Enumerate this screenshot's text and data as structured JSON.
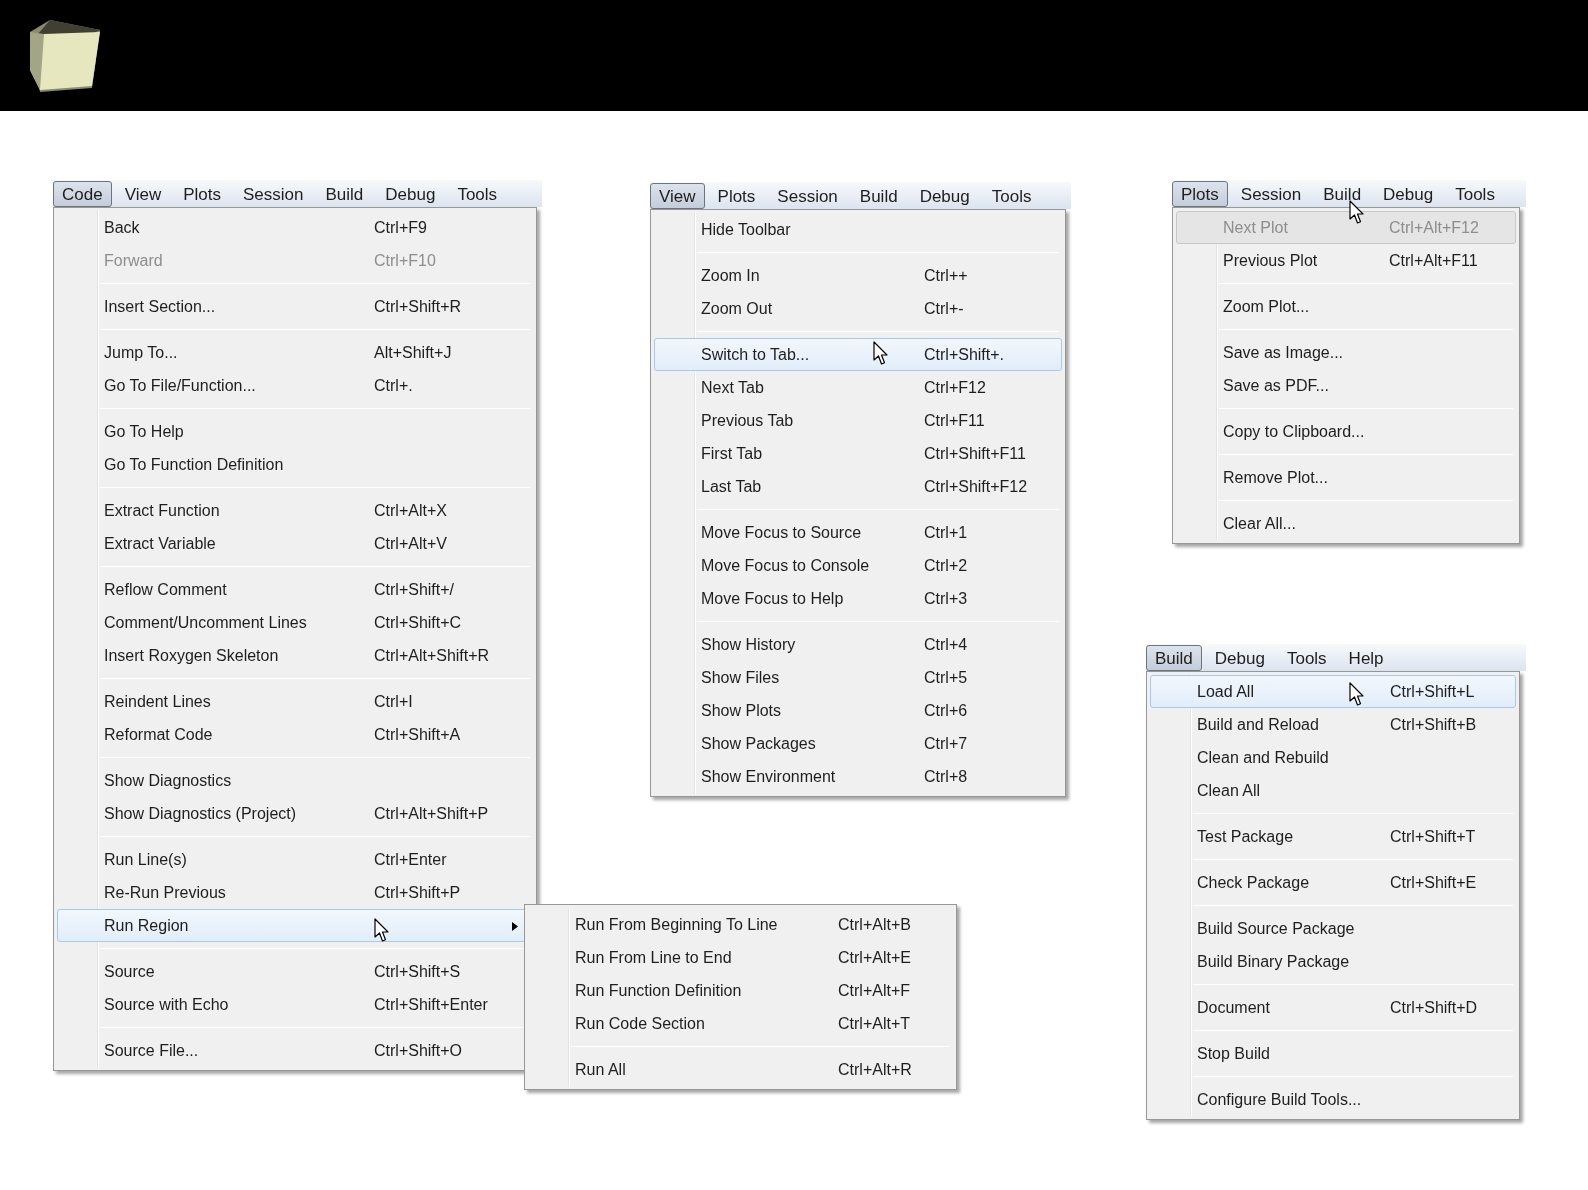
{
  "menus": [
    {
      "menubar": [
        {
          "label": "Code",
          "selected": true
        },
        {
          "label": "View",
          "selected": false
        },
        {
          "label": "Plots",
          "selected": false
        },
        {
          "label": "Session",
          "selected": false
        },
        {
          "label": "Build",
          "selected": false
        },
        {
          "label": "Debug",
          "selected": false
        },
        {
          "label": "Tools",
          "selected": false
        }
      ],
      "groups": [
        [
          {
            "label": "Back",
            "shortcut": "Ctrl+F9",
            "disabled": false,
            "selected": false
          },
          {
            "label": "Forward",
            "shortcut": "Ctrl+F10",
            "disabled": true,
            "selected": false
          }
        ],
        [
          {
            "label": "Insert Section...",
            "shortcut": "Ctrl+Shift+R",
            "disabled": false,
            "selected": false
          }
        ],
        [
          {
            "label": "Jump To...",
            "shortcut": "Alt+Shift+J",
            "disabled": false,
            "selected": false
          },
          {
            "label": "Go To File/Function...",
            "shortcut": "Ctrl+.",
            "disabled": false,
            "selected": false
          }
        ],
        [
          {
            "label": "Go To Help",
            "disabled": false,
            "selected": false
          },
          {
            "label": "Go To Function Definition",
            "disabled": false,
            "selected": false
          }
        ],
        [
          {
            "label": "Extract Function",
            "shortcut": "Ctrl+Alt+X",
            "disabled": false,
            "selected": false
          },
          {
            "label": "Extract Variable",
            "shortcut": "Ctrl+Alt+V",
            "disabled": false,
            "selected": false
          }
        ],
        [
          {
            "label": "Reflow Comment",
            "shortcut": "Ctrl+Shift+/",
            "disabled": false,
            "selected": false
          },
          {
            "label": "Comment/Uncomment Lines",
            "shortcut": "Ctrl+Shift+C",
            "disabled": false,
            "selected": false
          },
          {
            "label": "Insert Roxygen Skeleton",
            "shortcut": "Ctrl+Alt+Shift+R",
            "disabled": false,
            "selected": false
          }
        ],
        [
          {
            "label": "Reindent Lines",
            "shortcut": "Ctrl+I",
            "disabled": false,
            "selected": false
          },
          {
            "label": "Reformat Code",
            "shortcut": "Ctrl+Shift+A",
            "disabled": false,
            "selected": false
          }
        ],
        [
          {
            "label": "Show Diagnostics",
            "disabled": false,
            "selected": false
          },
          {
            "label": "Show Diagnostics (Project)",
            "shortcut": "Ctrl+Alt+Shift+P",
            "disabled": false,
            "selected": false
          }
        ],
        [
          {
            "label": "Run Line(s)",
            "shortcut": "Ctrl+Enter",
            "disabled": false,
            "selected": false
          },
          {
            "label": "Re-Run Previous",
            "shortcut": "Ctrl+Shift+P",
            "disabled": false,
            "selected": false
          },
          {
            "label": "Run Region",
            "disabled": false,
            "selected": true,
            "submenu": [
              [
                {
                  "label": "Run From Beginning To Line",
                  "shortcut": "Ctrl+Alt+B",
                  "disabled": false,
                  "selected": false
                },
                {
                  "label": "Run From Line to End",
                  "shortcut": "Ctrl+Alt+E",
                  "disabled": false,
                  "selected": false
                },
                {
                  "label": "Run Function Definition",
                  "shortcut": "Ctrl+Alt+F",
                  "disabled": false,
                  "selected": false
                },
                {
                  "label": "Run Code Section",
                  "shortcut": "Ctrl+Alt+T",
                  "disabled": false,
                  "selected": false
                }
              ],
              [
                {
                  "label": "Run All",
                  "shortcut": "Ctrl+Alt+R",
                  "disabled": false,
                  "selected": false
                }
              ]
            ]
          }
        ],
        [
          {
            "label": "Source",
            "shortcut": "Ctrl+Shift+S",
            "disabled": false,
            "selected": false
          },
          {
            "label": "Source with Echo",
            "shortcut": "Ctrl+Shift+Enter",
            "disabled": false,
            "selected": false
          }
        ],
        [
          {
            "label": "Source File...",
            "shortcut": "Ctrl+Shift+O",
            "disabled": false,
            "selected": false
          }
        ]
      ]
    },
    {
      "menubar": [
        {
          "label": "View",
          "selected": true
        },
        {
          "label": "Plots",
          "selected": false
        },
        {
          "label": "Session",
          "selected": false
        },
        {
          "label": "Build",
          "selected": false
        },
        {
          "label": "Debug",
          "selected": false
        },
        {
          "label": "Tools",
          "selected": false
        }
      ],
      "groups": [
        [
          {
            "label": "Hide Toolbar",
            "disabled": false,
            "selected": false
          }
        ],
        [
          {
            "label": "Zoom In",
            "shortcut": "Ctrl++",
            "disabled": false,
            "selected": false
          },
          {
            "label": "Zoom Out",
            "shortcut": "Ctrl+-",
            "disabled": false,
            "selected": false
          }
        ],
        [
          {
            "label": "Switch to Tab...",
            "shortcut": "Ctrl+Shift+.",
            "disabled": false,
            "selected": true
          },
          {
            "label": "Next Tab",
            "shortcut": "Ctrl+F12",
            "disabled": false,
            "selected": false
          },
          {
            "label": "Previous Tab",
            "shortcut": "Ctrl+F11",
            "disabled": false,
            "selected": false
          },
          {
            "label": "First Tab",
            "shortcut": "Ctrl+Shift+F11",
            "disabled": false,
            "selected": false
          },
          {
            "label": "Last Tab",
            "shortcut": "Ctrl+Shift+F12",
            "disabled": false,
            "selected": false
          }
        ],
        [
          {
            "label": "Move Focus to Source",
            "shortcut": "Ctrl+1",
            "disabled": false,
            "selected": false
          },
          {
            "label": "Move Focus to Console",
            "shortcut": "Ctrl+2",
            "disabled": false,
            "selected": false
          },
          {
            "label": "Move Focus to Help",
            "shortcut": "Ctrl+3",
            "disabled": false,
            "selected": false
          }
        ],
        [
          {
            "label": "Show History",
            "shortcut": "Ctrl+4",
            "disabled": false,
            "selected": false
          },
          {
            "label": "Show Files",
            "shortcut": "Ctrl+5",
            "disabled": false,
            "selected": false
          },
          {
            "label": "Show Plots",
            "shortcut": "Ctrl+6",
            "disabled": false,
            "selected": false
          },
          {
            "label": "Show Packages",
            "shortcut": "Ctrl+7",
            "disabled": false,
            "selected": false
          },
          {
            "label": "Show Environment",
            "shortcut": "Ctrl+8",
            "disabled": false,
            "selected": false
          }
        ]
      ]
    },
    {
      "menubar": [
        {
          "label": "Plots",
          "selected": true
        },
        {
          "label": "Session",
          "selected": false
        },
        {
          "label": "Build",
          "selected": false
        },
        {
          "label": "Debug",
          "selected": false
        },
        {
          "label": "Tools",
          "selected": false
        }
      ],
      "groups": [
        [
          {
            "label": "Next Plot",
            "shortcut": "Ctrl+Alt+F12",
            "disabled": true,
            "selected": true
          },
          {
            "label": "Previous Plot",
            "shortcut": "Ctrl+Alt+F11",
            "disabled": false,
            "selected": false
          }
        ],
        [
          {
            "label": "Zoom Plot...",
            "disabled": false,
            "selected": false
          }
        ],
        [
          {
            "label": "Save as Image...",
            "disabled": false,
            "selected": false
          },
          {
            "label": "Save as PDF...",
            "disabled": false,
            "selected": false
          }
        ],
        [
          {
            "label": "Copy to Clipboard...",
            "disabled": false,
            "selected": false
          }
        ],
        [
          {
            "label": "Remove Plot...",
            "disabled": false,
            "selected": false
          }
        ],
        [
          {
            "label": "Clear All...",
            "disabled": false,
            "selected": false
          }
        ]
      ]
    },
    {
      "menubar": [
        {
          "label": "Build",
          "selected": true
        },
        {
          "label": "Debug",
          "selected": false
        },
        {
          "label": "Tools",
          "selected": false
        },
        {
          "label": "Help",
          "selected": false
        }
      ],
      "groups": [
        [
          {
            "label": "Load All",
            "shortcut": "Ctrl+Shift+L",
            "disabled": false,
            "selected": true
          },
          {
            "label": "Build and Reload",
            "shortcut": "Ctrl+Shift+B",
            "disabled": false,
            "selected": false
          },
          {
            "label": "Clean and Rebuild",
            "disabled": false,
            "selected": false
          },
          {
            "label": "Clean All",
            "disabled": false,
            "selected": false
          }
        ],
        [
          {
            "label": "Test Package",
            "shortcut": "Ctrl+Shift+T",
            "disabled": false,
            "selected": false
          }
        ],
        [
          {
            "label": "Check Package",
            "shortcut": "Ctrl+Shift+E",
            "disabled": false,
            "selected": false
          }
        ],
        [
          {
            "label": "Build Source Package",
            "disabled": false,
            "selected": false
          },
          {
            "label": "Build Binary Package",
            "disabled": false,
            "selected": false
          }
        ],
        [
          {
            "label": "Document",
            "shortcut": "Ctrl+Shift+D",
            "disabled": false,
            "selected": false
          }
        ],
        [
          {
            "label": "Stop Build",
            "disabled": false,
            "selected": false
          }
        ],
        [
          {
            "label": "Configure Build Tools...",
            "disabled": false,
            "selected": false
          }
        ]
      ]
    }
  ]
}
